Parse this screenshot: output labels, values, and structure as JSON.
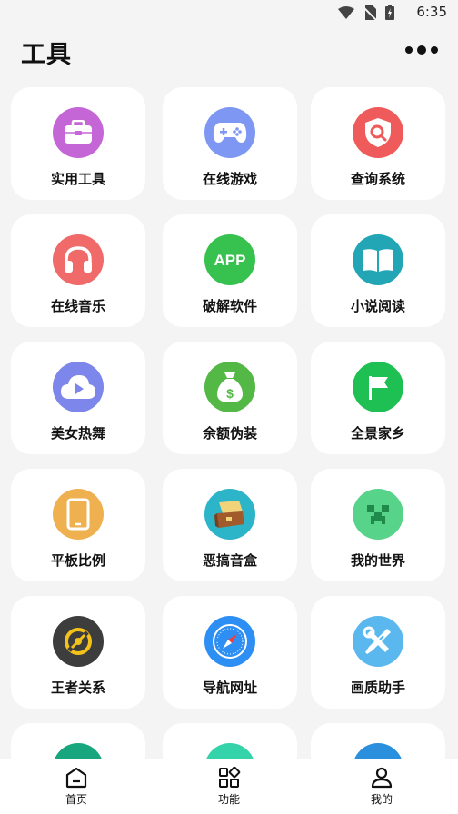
{
  "status_bar": {
    "time": "6:35"
  },
  "header": {
    "title": "工具"
  },
  "tools": [
    {
      "label": "实用工具",
      "icon": "toolbox-icon",
      "color": "#c466d6"
    },
    {
      "label": "在线游戏",
      "icon": "gamepad-icon",
      "color": "#7e97f2"
    },
    {
      "label": "查询系统",
      "icon": "shield-search-icon",
      "color": "#ef5a5a"
    },
    {
      "label": "在线音乐",
      "icon": "headphones-icon",
      "color": "#f06a6a"
    },
    {
      "label": "破解软件",
      "icon": "app-icon",
      "color": "#37c24f"
    },
    {
      "label": "小说阅读",
      "icon": "book-icon",
      "color": "#22a6b5"
    },
    {
      "label": "美女热舞",
      "icon": "cloud-play-icon",
      "color": "#7d86ea"
    },
    {
      "label": "余额伪装",
      "icon": "money-bag-icon",
      "color": "#54b847"
    },
    {
      "label": "全景家乡",
      "icon": "flag-icon",
      "color": "#1ec054"
    },
    {
      "label": "平板比例",
      "icon": "tablet-icon",
      "color": "#efb04f"
    },
    {
      "label": "恶搞音盒",
      "icon": "music-box-icon",
      "color": "#2cb4c8"
    },
    {
      "label": "我的世界",
      "icon": "creeper-icon",
      "color": "#57d38a"
    },
    {
      "label": "王者关系",
      "icon": "game-emblem-icon",
      "color": "#3d3d3d"
    },
    {
      "label": "导航网址",
      "icon": "compass-icon",
      "color": "#2d8ff3"
    },
    {
      "label": "画质助手",
      "icon": "wrench-screwdriver-icon",
      "color": "#5ab8ef"
    },
    {
      "label": "",
      "icon": "partial-icon",
      "color": "#17a67e"
    },
    {
      "label": "",
      "icon": "partial-icon",
      "color": "#34d3a9"
    },
    {
      "label": "",
      "icon": "partial-icon",
      "color": "#2a8fdc"
    }
  ],
  "nav": [
    {
      "label": "首页",
      "icon": "home-icon"
    },
    {
      "label": "功能",
      "icon": "grid-icon"
    },
    {
      "label": "我的",
      "icon": "user-icon"
    }
  ]
}
